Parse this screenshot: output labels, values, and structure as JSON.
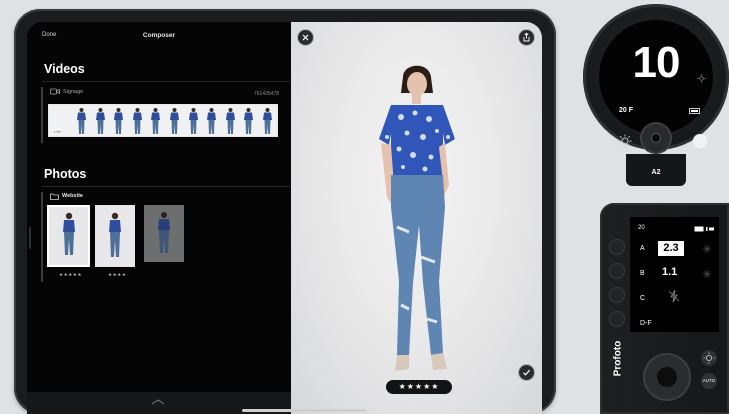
{
  "ipad": {
    "topbar": {
      "done_label": "Done",
      "title": "Composer"
    },
    "videos": {
      "title": "Videos",
      "group_name": "Signage",
      "group_id": "761435478",
      "frame_count": 11,
      "duration_label": "1:59"
    },
    "photos": {
      "title": "Photos",
      "group_name": "Website",
      "thumbs": [
        {
          "rating": "★★★★★",
          "selected": true
        },
        {
          "rating": "★★★★",
          "selected": false
        },
        {
          "rating": "",
          "selected": false
        }
      ]
    },
    "preview": {
      "rating": "★★★★★",
      "icons": [
        "close-icon",
        "share-icon",
        "check-icon"
      ]
    }
  },
  "a2_head": {
    "value": "10",
    "channel": "20 F",
    "label": "A2"
  },
  "remote": {
    "channel": "20",
    "groups": [
      {
        "name": "A",
        "value": "2.3"
      },
      {
        "name": "B",
        "value": "1.1"
      },
      {
        "name": "C",
        "value": ""
      },
      {
        "name": "D-F",
        "value": ""
      }
    ],
    "brand": "Profoto",
    "auto_label": "AUTO"
  }
}
